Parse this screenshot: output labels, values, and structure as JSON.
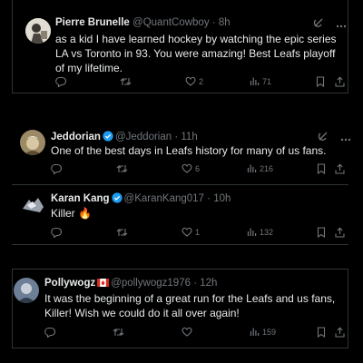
{
  "tweets": [
    {
      "name": "Pierre Brunelle",
      "handle": "@QuantCowboy",
      "time": "8h",
      "text": "as a kid I have learned hockey by watching the epic series LA vs Toronto in 93. You were amazing! Best Leafs playoff of my lifetime.",
      "likes": "2",
      "views": "71",
      "verified": false
    },
    {
      "name": "Jeddorian",
      "handle": "@Jeddorian",
      "time": "11h",
      "text": "One of the best days in Leafs history for many of us fans.",
      "likes": "6",
      "views": "216",
      "verified": true
    },
    {
      "name": "Karan Kang",
      "handle": "@KaranKang017",
      "time": "10h",
      "text": "Killer 🔥",
      "likes": "1",
      "views": "132",
      "verified": true
    },
    {
      "name": "Pollywogz",
      "handle": "@pollywogz1976",
      "time": "12h",
      "text": "It was the beginning of a great run for the Leafs and us fans, Killer! Wish we could do it all over again!",
      "likes": "",
      "views": "159",
      "verified": false
    }
  ],
  "colors": {
    "background": "#000000",
    "text": "#e7e9ea",
    "muted": "#71767b",
    "verified": "#1d9bf0",
    "border": "#2f3336"
  },
  "icons": [
    "reply-icon",
    "retweet-icon",
    "like-icon",
    "views-icon",
    "bookmark-icon",
    "share-icon",
    "grok-icon",
    "more-icon",
    "verified-badge-icon",
    "canada-flag-icon"
  ]
}
